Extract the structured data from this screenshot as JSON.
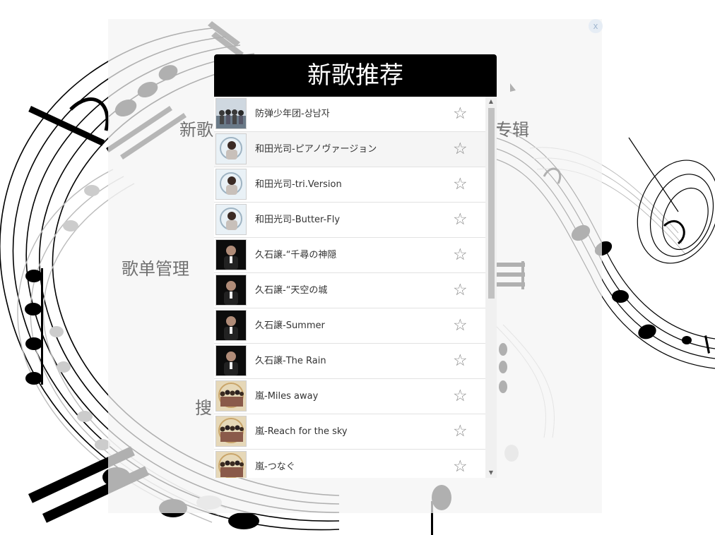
{
  "dialog": {
    "title": "新歌推荐"
  },
  "close_label": "x",
  "menu": {
    "new_songs": "新歌",
    "album": "专辑",
    "playlists": "歌单管理",
    "search": "搜"
  },
  "songs": [
    {
      "title": "防弹少年团-상남자",
      "cover": "group-photo",
      "favorite_icon": "☆"
    },
    {
      "title": "和田光司-ピアノヴァージョン",
      "cover": "singer-portrait",
      "favorite_icon": "☆"
    },
    {
      "title": "和田光司-tri.Version",
      "cover": "singer-portrait",
      "favorite_icon": "☆"
    },
    {
      "title": "和田光司-Butter-Fly",
      "cover": "singer-portrait",
      "favorite_icon": "☆"
    },
    {
      "title": "久石譲-“千尋の神隠",
      "cover": "pianist-dark",
      "favorite_icon": "☆"
    },
    {
      "title": "久石譲-“天空の城",
      "cover": "pianist-dark",
      "favorite_icon": "☆"
    },
    {
      "title": "久石譲-Summer",
      "cover": "pianist-dark",
      "favorite_icon": "☆"
    },
    {
      "title": "久石譲-The Rain",
      "cover": "pianist-dark",
      "favorite_icon": "☆"
    },
    {
      "title": "嵐-Miles away",
      "cover": "band-photo",
      "favorite_icon": "☆"
    },
    {
      "title": "嵐-Reach for the sky",
      "cover": "band-photo",
      "favorite_icon": "☆"
    },
    {
      "title": "嵐-つなぐ",
      "cover": "band-photo",
      "favorite_icon": "☆"
    }
  ],
  "scrollbar": {
    "up_arrow": "▲",
    "down_arrow": "▼"
  },
  "colors": {
    "header_bg": "#000000",
    "header_text": "#ffffff",
    "star": "#8a8a8a"
  }
}
